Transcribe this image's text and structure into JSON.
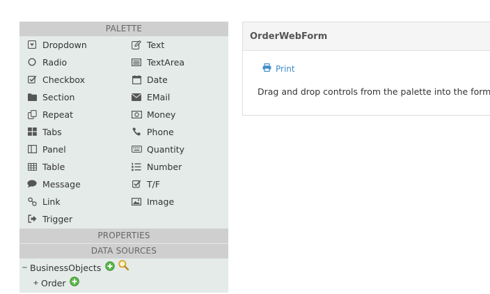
{
  "palette": {
    "header": "PALETTE",
    "left_items": [
      {
        "label": "Dropdown",
        "icon": "dropdown-icon"
      },
      {
        "label": "Radio",
        "icon": "radio-icon"
      },
      {
        "label": "Checkbox",
        "icon": "checkbox-icon"
      },
      {
        "label": "Section",
        "icon": "folder-icon"
      },
      {
        "label": "Repeat",
        "icon": "repeat-icon"
      },
      {
        "label": "Tabs",
        "icon": "tabs-icon"
      },
      {
        "label": "Panel",
        "icon": "panel-icon"
      },
      {
        "label": "Table",
        "icon": "table-icon"
      },
      {
        "label": "Message",
        "icon": "message-icon"
      },
      {
        "label": "Link",
        "icon": "link-icon"
      },
      {
        "label": "Trigger",
        "icon": "trigger-icon"
      }
    ],
    "right_items": [
      {
        "label": "Text",
        "icon": "pencil-icon"
      },
      {
        "label": "TextArea",
        "icon": "textarea-icon"
      },
      {
        "label": "Date",
        "icon": "calendar-icon"
      },
      {
        "label": "EMail",
        "icon": "envelope-icon"
      },
      {
        "label": "Money",
        "icon": "money-icon"
      },
      {
        "label": "Phone",
        "icon": "phone-icon"
      },
      {
        "label": "Quantity",
        "icon": "keyboard-icon"
      },
      {
        "label": "Number",
        "icon": "numbered-list-icon"
      },
      {
        "label": "T/F",
        "icon": "checkbox-icon"
      },
      {
        "label": "Image",
        "icon": "image-icon"
      }
    ]
  },
  "properties": {
    "header": "PROPERTIES"
  },
  "data_sources": {
    "header": "DATA SOURCES",
    "root": {
      "label": "BusinessObjects",
      "toggle": "−"
    },
    "children": [
      {
        "label": "Order",
        "toggle": "+"
      }
    ]
  },
  "form": {
    "title": "OrderWebForm",
    "print_label": "Print",
    "description": "Drag and drop controls from the palette into the form."
  },
  "colors": {
    "panel_bg": "#e4ebe8",
    "header_bg": "#cfcfcf",
    "link": "#3f8fc9",
    "add_green": "#4caf3a",
    "search_gold": "#d6a52b"
  }
}
